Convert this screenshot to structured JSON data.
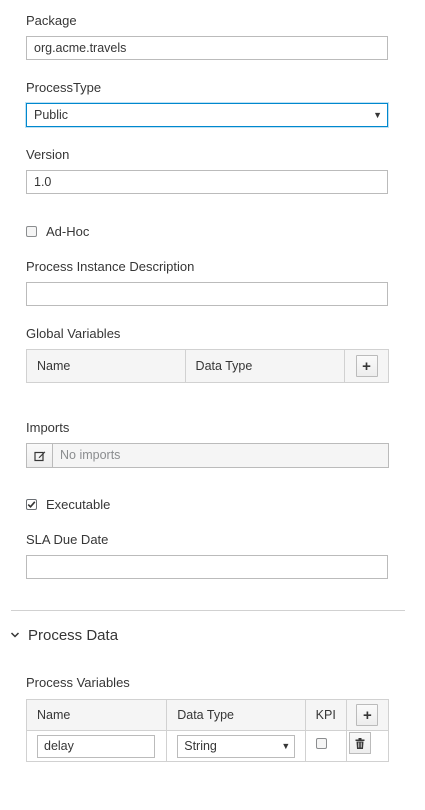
{
  "package": {
    "label": "Package",
    "value": "org.acme.travels"
  },
  "process_type": {
    "label": "ProcessType",
    "value": "Public"
  },
  "version": {
    "label": "Version",
    "value": "1.0"
  },
  "adhoc": {
    "label": "Ad-Hoc",
    "checked": false
  },
  "instance_description": {
    "label": "Process Instance Description",
    "value": ""
  },
  "global_variables": {
    "label": "Global Variables",
    "columns": [
      "Name",
      "Data Type"
    ],
    "add_symbol": "+"
  },
  "imports": {
    "label": "Imports",
    "placeholder": "No imports"
  },
  "executable": {
    "label": "Executable",
    "checked": true
  },
  "sla_due_date": {
    "label": "SLA Due Date",
    "value": ""
  },
  "process_data": {
    "section_title": "Process Data",
    "variables_label": "Process Variables",
    "columns": [
      "Name",
      "Data Type",
      "KPI"
    ],
    "add_symbol": "+",
    "rows": [
      {
        "name": "delay",
        "data_type": "String",
        "kpi": false
      }
    ]
  }
}
